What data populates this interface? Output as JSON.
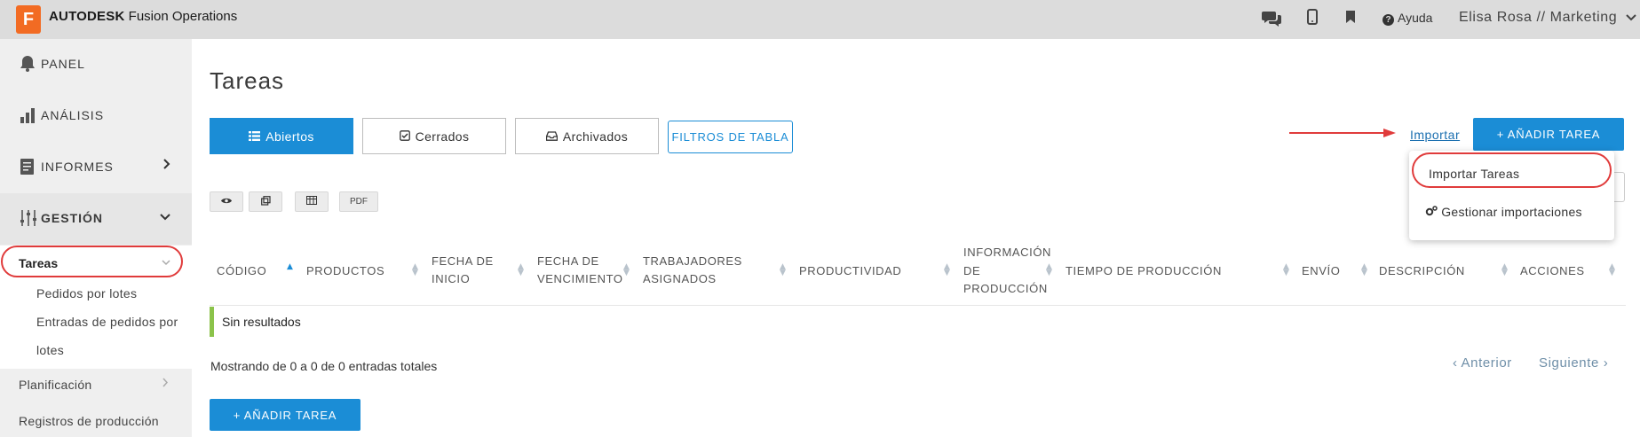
{
  "app": {
    "logo_letter": "F",
    "brand": "AUTODESK",
    "product": "Fusion Operations",
    "help_label": "Ayuda",
    "user_label": "Elisa Rosa // Marketing",
    "icons": [
      "chat-icon",
      "mobile-icon",
      "bookmark-icon",
      "help-icon"
    ]
  },
  "sidebar": {
    "panel": "PANEL",
    "analisis": "ANÁLISIS",
    "informes": "INFORMES",
    "gestion": "GESTIÓN",
    "tareas": "Tareas",
    "children": [
      "Pedidos por lotes",
      "Entradas de pedidos por",
      "lotes"
    ],
    "planificacion": "Planificación",
    "registros": "Registros de producción"
  },
  "main": {
    "title": "Tareas",
    "tabs": [
      {
        "label": "Abiertos",
        "active": true
      },
      {
        "label": "Cerrados",
        "active": false
      },
      {
        "label": "Archivados",
        "active": false
      }
    ],
    "filters_button": "FILTROS DE TABLA",
    "import_link": "Importar",
    "add_task": "+ AÑADIR TAREA",
    "dropdown": {
      "item1": "Importar Tareas",
      "item2": "Gestionar importaciones"
    },
    "tools": {
      "pdf": "PDF"
    },
    "columns": {
      "codigo": "CÓDIGO",
      "productos": "PRODUCTOS",
      "fecha_inicio_1": "FECHA DE",
      "fecha_inicio_2": "INICIO",
      "fecha_venc_1": "FECHA DE",
      "fecha_venc_2": "VENCIMIENTO",
      "trabajadores_1": "TRABAJADORES",
      "trabajadores_2": "ASIGNADOS",
      "productividad": "PRODUCTIVIDAD",
      "info_1": "INFORMACIÓN",
      "info_2": "DE",
      "info_3": "PRODUCCIÓN",
      "tiempo": "TIEMPO DE PRODUCCIÓN",
      "envio": "ENVÍO",
      "descripcion": "DESCRIPCIÓN",
      "acciones": "ACCIONES"
    },
    "empty_text": "Sin resultados",
    "showing_text": "Mostrando de 0 a 0 de 0 entradas totales",
    "pager": {
      "prev": "‹ Anterior",
      "next": "Siguiente ›"
    }
  },
  "colors": {
    "accent": "#1b8dd6",
    "brand_orange": "#f26b23",
    "annotation_red": "#e03b3b",
    "empty_bar": "#8bc34a"
  }
}
